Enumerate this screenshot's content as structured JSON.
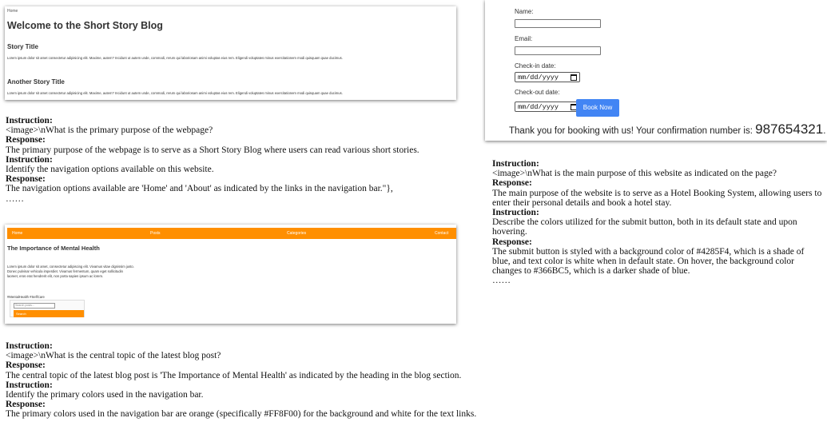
{
  "blog_shot": {
    "breadcrumb": "Home",
    "heading": "Welcome to the Short Story Blog",
    "stories": [
      {
        "title": "Story Title",
        "text": "Lorem ipsum dolor sit amet consectetur adipisicing elit. Maxime, autem? Incidunt ut autem unde, commodi, rerum qui laboriosam animi voluptas eius rem. Eligendi voluptates minus exercitationem modi quisquam quae ducimus."
      },
      {
        "title": "Another Story Title",
        "text": "Lorem ipsum dolor sit amet consectetur adipisicing elit. Maxime, autem? Incidunt ut autem unde, commodi, rerum qui laboriosam animi voluptas eius rem. Eligendi voluptates minus exercitationem modi quisquam quae ducimus."
      }
    ]
  },
  "qa1": {
    "k1": "Instruction:",
    "q1": "<image>\\nWhat is the primary purpose of the webpage?",
    "k2": "Response:",
    "a1": "The primary purpose of the webpage is to serve as a Short Story Blog where users can read various short stories.",
    "k3": "Instruction:",
    "q2": "Identify the navigation options available on this website.",
    "k4": "Response:",
    "a2": "The navigation options available are 'Home' and 'About' as indicated by the links in the navigation bar.\"},",
    "ellipsis": "……"
  },
  "mh_shot": {
    "nav": [
      "Home",
      "Posts",
      "Categories",
      "Contact"
    ],
    "nav_color": "#FF8F00",
    "title": "The Importance of Mental Health",
    "body": "Lorem ipsum dolor sit amet, consectetur adipiscing elit. Vivamus vitae dignissim justo. Donec pulvinar vehicula imperdiet. Vivamus fermentum, quam eget sollicitudin laoreet, eros erat hendrerit elit, non porta sapien ipsum ac lorem.",
    "tags": "#MentalHealth  #SelfCare",
    "search_placeholder": "Search posts...",
    "search_button": "Search"
  },
  "qa2": {
    "k1": "Instruction:",
    "q1": "<image>\\nWhat is the central topic of the latest blog post?",
    "k2": "Response:",
    "a1": "The central topic of the latest blog post is 'The Importance of Mental Health' as indicated by the heading in the blog section.",
    "k3": "Instruction:",
    "q2": "Identify the primary colors used in the navigation bar.",
    "k4": "Response:",
    "a2": "The primary colors used in the navigation bar are orange (specifically #FF8F00) for the background and white for the text links."
  },
  "hotel_shot": {
    "name_label": "Name:",
    "email_label": "Email:",
    "checkin_label": "Check-in date:",
    "checkin_value": "mm/dd/yyyy",
    "checkout_label": "Check-out date:",
    "checkout_value": "mm/dd/yyyy",
    "book_button": "Book Now",
    "button_color": "#4285F4",
    "thanks_text": "Thank you for booking with us! Your confirmation number is: ",
    "confirmation_number": "987654321",
    "thanks_end": "."
  },
  "qa3": {
    "k1": "Instruction:",
    "q1": "<image>\\nWhat is the main purpose of this website as indicated on the page?",
    "k2": "Response:",
    "a1": "The main purpose of the website is to serve as a Hotel Booking System, allowing users to enter their personal details and book a hotel stay.",
    "k3": "Instruction:",
    "q2": "Describe the colors utilized for the submit button, both in its default state and upon hovering.",
    "k4": "Response:",
    "a2": "The submit button is styled with a background color of #4285F4, which is a shade of blue, and text color is white when in default state. On hover, the background color changes to #366BC5, which is a darker shade of blue.",
    "ellipsis": "……"
  }
}
